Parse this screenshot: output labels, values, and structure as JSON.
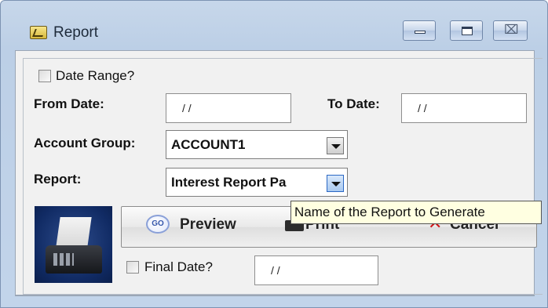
{
  "window": {
    "title": "Report",
    "icon": "report-icon",
    "controls": [
      "minimize-icon",
      "maximize-icon",
      "close-icon"
    ],
    "close_glyph": "⌧"
  },
  "form": {
    "date_range_label": "Date Range?",
    "date_range_checked": false,
    "from_date_label": "From Date:",
    "from_date_value": "/ /",
    "to_date_label": "To Date:",
    "to_date_value": "/ /",
    "account_group_label": "Account Group:",
    "account_group_value": "ACCOUNT1",
    "report_label": "Report:",
    "report_value": "Interest Report Pa",
    "final_date_label": "Final Date?",
    "final_date_checked": false,
    "final_date_value": "/ /"
  },
  "buttons": {
    "preview_label": "Preview",
    "preview_icon_text": "GO",
    "print_label": "Print",
    "cancel_label": "Cancel"
  },
  "tooltip": {
    "text": "Name of the Report to Generate"
  },
  "colors": {
    "titlebar": "#bccfe6",
    "tooltip_bg": "#ffffe1",
    "cancel_x": "#d01818"
  }
}
